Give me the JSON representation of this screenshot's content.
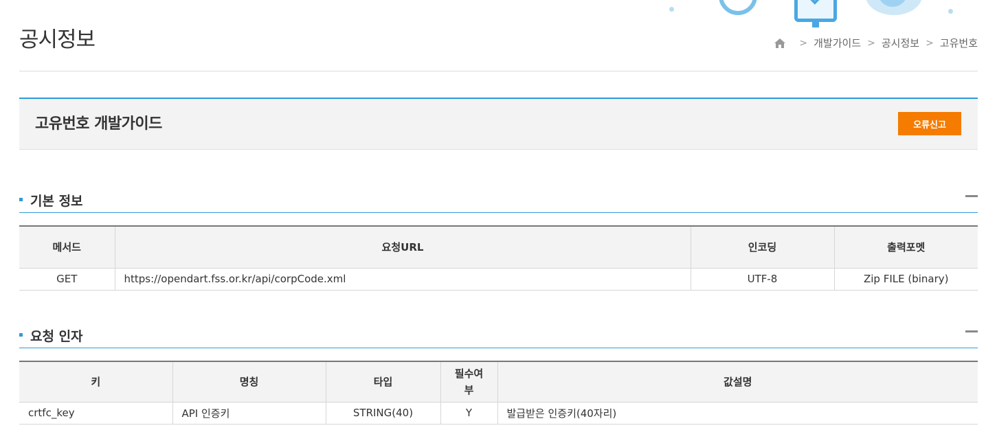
{
  "page": {
    "title": "공시정보"
  },
  "breadcrumb": {
    "items": [
      "개발가이드",
      "공시정보",
      "고유번호"
    ]
  },
  "guide": {
    "title": "고유번호 개발가이드",
    "report_button": "오류신고"
  },
  "colors": {
    "accent": "#2f9ad8",
    "report_button": "#f57c00"
  },
  "sections": {
    "basic": {
      "title": "기본 정보",
      "headers": [
        "메서드",
        "요청URL",
        "인코딩",
        "출력포멧"
      ],
      "rows": [
        [
          "GET",
          "https://opendart.fss.or.kr/api/corpCode.xml",
          "UTF-8",
          "Zip FILE (binary)"
        ]
      ]
    },
    "request": {
      "title": "요청 인자",
      "headers": [
        "키",
        "명칭",
        "타입",
        "필수여부",
        "값설명"
      ],
      "rows": [
        [
          "crtfc_key",
          "API 인증키",
          "STRING(40)",
          "Y",
          "발급받은 인증키(40자리)"
        ]
      ]
    }
  }
}
